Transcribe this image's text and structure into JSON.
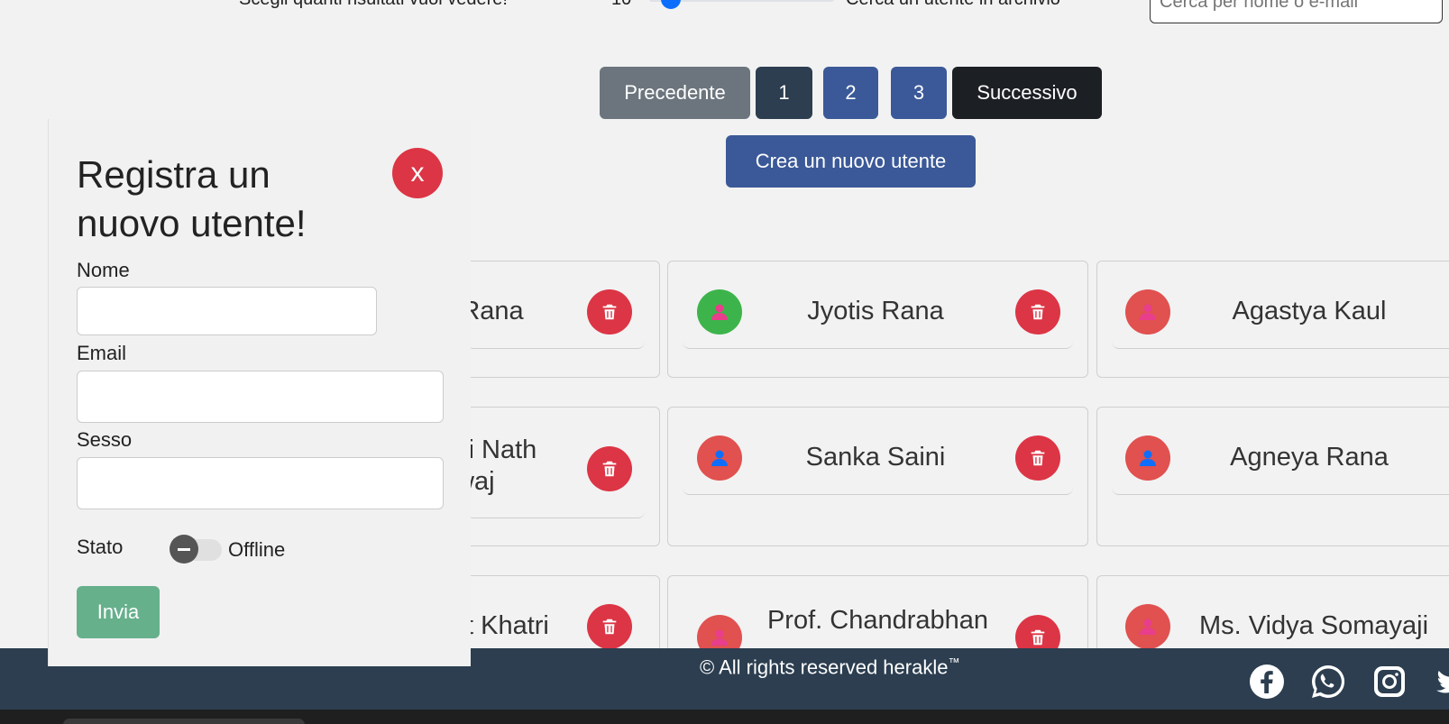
{
  "controls": {
    "results_label": "Scegli quanti risultati vuoi vedere!",
    "results_value": "10",
    "search_label": "Cerca un utente in archivio",
    "search_placeholder": "Cerca per nome o e-mail"
  },
  "pagination": {
    "prev": "Precedente",
    "pages": [
      "1",
      "2",
      "3"
    ],
    "next": "Successivo"
  },
  "create_button": "Crea un nuovo utente",
  "cards": [
    {
      "name": "Rana",
      "avatar_color": "#e0514f",
      "icon_color": "#e83e8c"
    },
    {
      "name": "Jyotis Rana",
      "avatar_color": "#3cb44b",
      "icon_color": "#e83e8c"
    },
    {
      "name": "Agastya Kaul",
      "avatar_color": "#e0514f",
      "icon_color": "#e83e8c"
    },
    {
      "name": "ki Nath waj",
      "avatar_color": "#e0514f",
      "icon_color": "#0d6efd"
    },
    {
      "name": "Sanka Saini",
      "avatar_color": "#e0514f",
      "icon_color": "#0d6efd"
    },
    {
      "name": "Agneya Rana",
      "avatar_color": "#e0514f",
      "icon_color": "#0d6efd"
    },
    {
      "name": "t Khatri",
      "avatar_color": "#e0514f",
      "icon_color": "#e83e8c"
    },
    {
      "name": "Prof. Chandrabhan Kh",
      "avatar_color": "#e0514f",
      "icon_color": "#e83e8c"
    },
    {
      "name": "Ms. Vidya Somayaji",
      "avatar_color": "#e0514f",
      "icon_color": "#e83e8c"
    }
  ],
  "modal": {
    "title": "Registra un nuovo utente!",
    "close": "x",
    "name_label": "Nome",
    "email_label": "Email",
    "gender_label": "Sesso",
    "status_label": "Stato",
    "status_value": "Offline",
    "submit": "Invia"
  },
  "footer": {
    "copyright": "© All rights reserved herakle",
    "trademark": "™",
    "social_icons": [
      "facebook-icon",
      "whatsapp-icon",
      "instagram-icon",
      "twitter-icon"
    ]
  },
  "colors": {
    "primary": "#3b5998",
    "danger": "#dc3545",
    "footer": "#2c3e50",
    "success": "#66b08c"
  }
}
